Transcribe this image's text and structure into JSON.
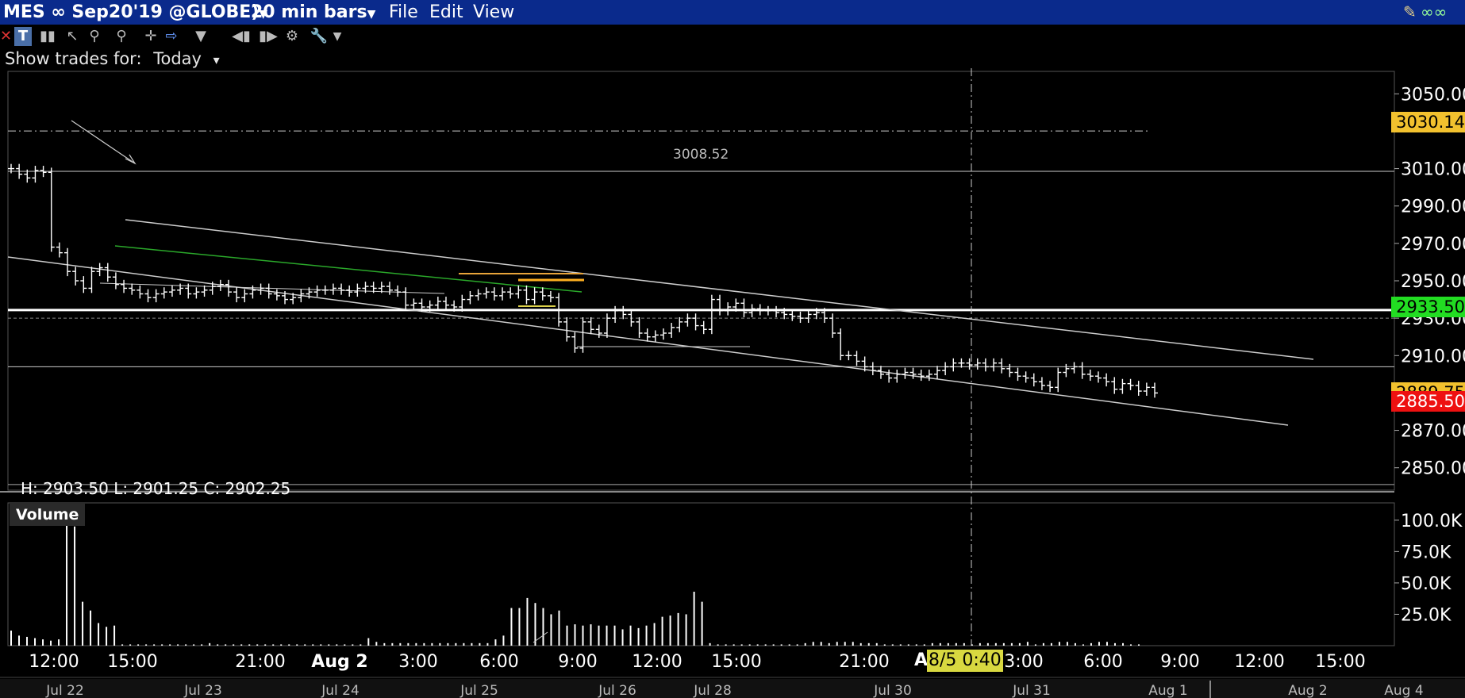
{
  "window": {
    "symbol_label": "MES ∞ Sep20'19 @GLOBE)",
    "bar_size_label": "20 min bars",
    "menu": [
      "File",
      "Edit",
      "View"
    ]
  },
  "toolbar": {
    "icons": [
      "close-icon",
      "text-tool-icon",
      "bars-icon",
      "pointer-icon",
      "magnifier-icon",
      "magnifier-minus-icon",
      "crosshair-icon",
      "arrow-right-icon",
      "filter-icon",
      "scroll-left-icon",
      "scroll-right-icon",
      "indicators-icon",
      "wrench-icon",
      "dropdown-icon"
    ]
  },
  "show_trades": {
    "label": "Show trades for:",
    "value": "Today",
    "arrow": "▾"
  },
  "annotations": {
    "level_label": "3008.52",
    "hlc": "H: 2903.50  L: 2901.25  C: 2902.25",
    "volume_label": "Volume",
    "crosshair_time": "8/5 0:40",
    "crosshair_prefix": "A"
  },
  "price_tags": [
    {
      "text": "3030.14",
      "color": "#f2c12e"
    },
    {
      "text": "2933.50",
      "color": "#22dd22"
    },
    {
      "text": "2885.50",
      "color": "#ee1111"
    },
    {
      "text": "2889.75",
      "color": "#f2c12e"
    }
  ],
  "chart_data": [
    {
      "type": "bar",
      "title": "",
      "ylim": [
        2838,
        3062
      ],
      "y_ticks": [
        "3050.00",
        "3010.00",
        "2990.00",
        "2970.00",
        "2950.00",
        "2930.00",
        "2910.00",
        "2870.00",
        "2850.00"
      ],
      "x_time_labels": [
        "12:00",
        "15:00",
        "21:00",
        "Aug 2",
        "3:00",
        "6:00",
        "9:00",
        "12:00",
        "15:00",
        "21:00",
        "3:00",
        "6:00",
        "9:00",
        "12:00",
        "15:00"
      ],
      "x_date_labels": [
        "Jul 22",
        "Jul 23",
        "Jul 24",
        "Jul 25",
        "Jul 26",
        "Jul 28",
        "Jul 30",
        "Jul 31",
        "Aug 1",
        "Aug 2",
        "Aug 4"
      ],
      "close": [
        3010,
        3007,
        3005,
        3009,
        3008,
        2968,
        2965,
        2955,
        2950,
        2946,
        2955,
        2957,
        2952,
        2948,
        2946,
        2945,
        2943,
        2941,
        2943,
        2944,
        2945,
        2946,
        2943,
        2944,
        2945,
        2947,
        2948,
        2944,
        2941,
        2943,
        2945,
        2946,
        2943,
        2942,
        2940,
        2941,
        2943,
        2944,
        2945,
        2945,
        2946,
        2945,
        2944,
        2946,
        2947,
        2946,
        2947,
        2945,
        2944,
        2937,
        2938,
        2936,
        2937,
        2939,
        2937,
        2936,
        2940,
        2942,
        2943,
        2944,
        2942,
        2944,
        2943,
        2945,
        2940,
        2944,
        2942,
        2941,
        2928,
        2920,
        2914,
        2928,
        2924,
        2922,
        2930,
        2934,
        2932,
        2928,
        2922,
        2920,
        2921,
        2922,
        2925,
        2928,
        2930,
        2926,
        2924,
        2940,
        2934,
        2936,
        2938,
        2933,
        2935,
        2934,
        2934,
        2933,
        2932,
        2931,
        2930,
        2932,
        2933,
        2930,
        2922,
        2910,
        2910,
        2907,
        2904,
        2902,
        2900,
        2898,
        2900,
        2901,
        2900,
        2899,
        2900,
        2902,
        2904,
        2906,
        2906,
        2905,
        2906,
        2904,
        2906,
        2903,
        2901,
        2899,
        2898,
        2896,
        2894,
        2893,
        2901,
        2903,
        2904,
        2900,
        2899,
        2898,
        2896,
        2892,
        2895,
        2894,
        2891,
        2893,
        2890
      ],
      "volume_k": [
        12,
        8,
        7,
        6,
        5,
        4,
        5,
        100,
        95,
        35,
        28,
        18,
        15,
        16,
        1,
        1,
        1,
        1,
        1,
        1,
        1,
        1,
        1,
        1,
        1,
        2,
        1,
        1,
        1,
        1,
        1,
        1,
        1,
        1,
        1,
        1,
        1,
        1,
        1,
        1,
        1,
        1,
        1,
        1,
        1,
        6,
        3,
        2,
        2,
        2,
        2,
        2,
        2,
        2,
        2,
        2,
        2,
        2,
        2,
        2,
        2,
        5,
        8,
        30,
        30,
        38,
        34,
        30,
        25,
        28,
        16,
        17,
        16,
        17,
        16,
        16,
        16,
        13,
        16,
        14,
        16,
        18,
        23,
        24,
        26,
        25,
        43,
        35,
        2,
        1,
        1,
        1,
        1,
        1,
        1,
        1,
        1,
        1,
        1,
        1,
        2,
        3,
        3,
        2,
        3,
        3,
        3,
        2,
        2,
        2,
        1,
        1,
        1,
        1,
        1,
        1,
        2,
        2,
        2,
        2,
        2,
        1,
        2,
        2,
        2,
        2,
        2,
        2,
        3,
        1,
        2,
        2,
        3,
        3,
        2,
        1,
        2,
        3,
        3,
        2,
        2,
        1,
        1
      ],
      "volume_ticks": [
        "100.0K",
        "75.0K",
        "50.0K",
        "25.0K"
      ],
      "volume_ylim": [
        0,
        110
      ]
    }
  ]
}
